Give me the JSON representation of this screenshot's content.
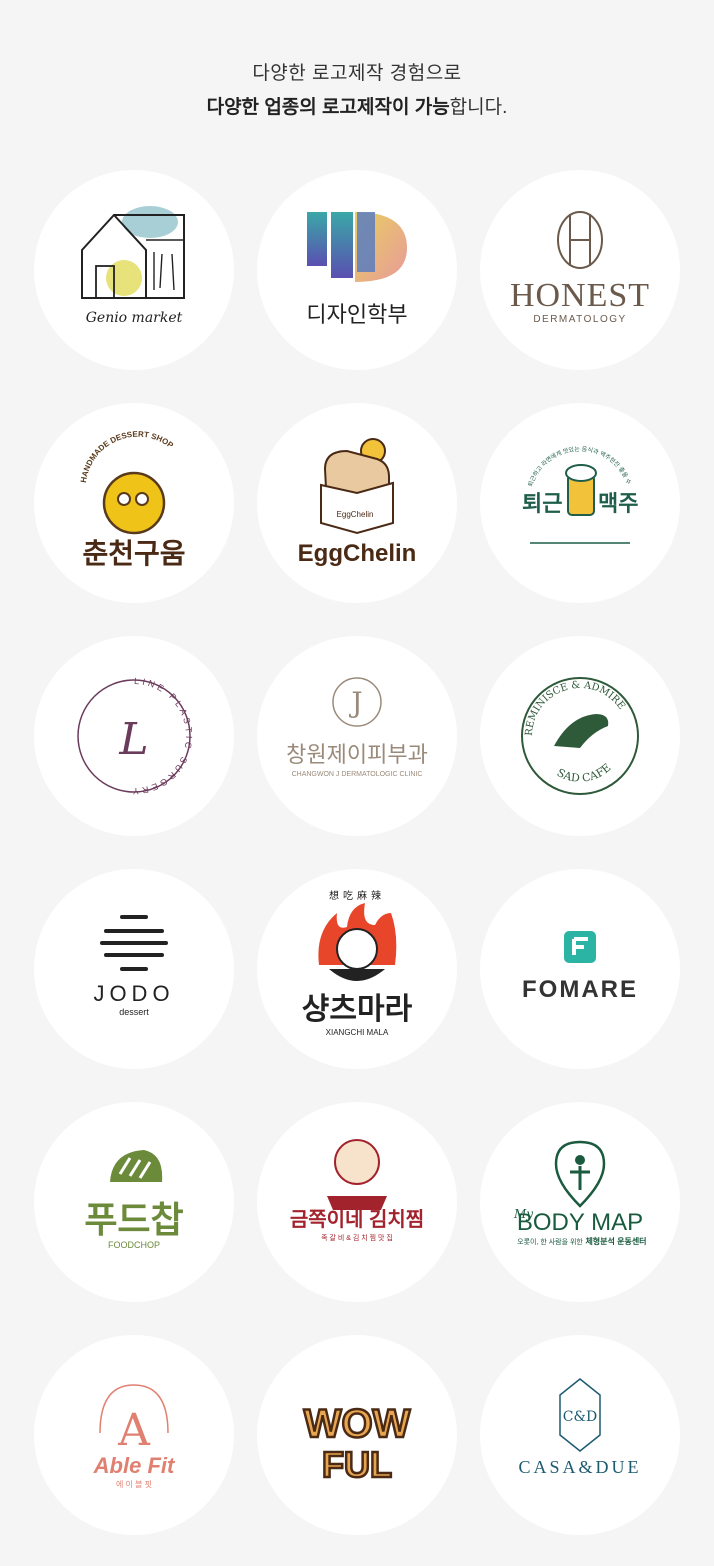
{
  "header": {
    "line1": "다양한 로고제작 경험으로",
    "line2_bold": "다양한 업종의 로고제작이 가능",
    "line2_rest": "합니다."
  },
  "logos": [
    {
      "name": "genio-market",
      "text": "Genio market"
    },
    {
      "name": "design-school",
      "text": "디자인학부"
    },
    {
      "name": "honest",
      "text": "HONEST",
      "sub": "DERMATOLOGY"
    },
    {
      "name": "chuncheon-baking",
      "text": "춘천구움",
      "sub": "HANDMADE DESSERT SHOP"
    },
    {
      "name": "eggchelin",
      "text": "EggChelin",
      "sub": "EggChelin"
    },
    {
      "name": "after-work-beer",
      "text": "퇴근",
      "text2": "맥주",
      "sub": "퇴근하고 라면에게 맛있는 음식과 맥주한잔 좋을 수 있는 곳"
    },
    {
      "name": "line-plastic",
      "text": "L",
      "sub": "LINE PLASTIC SURGERY"
    },
    {
      "name": "changwon-derma",
      "text": "창원제이피부과",
      "sub": "CHANGWON J DERMATOLOGIC CLINIC",
      "mono": "J"
    },
    {
      "name": "sad-cafe",
      "text": "REMINISCE & ADMIRE",
      "sub": "SAD CAFE"
    },
    {
      "name": "jodo",
      "text": "JODO",
      "sub": "dessert"
    },
    {
      "name": "xiangchi-mala",
      "text": "샹츠마라",
      "sub": "XIANGCHI MALA",
      "top": "想吃麻辣"
    },
    {
      "name": "fomare",
      "text": "FOMARE"
    },
    {
      "name": "foodchop",
      "text": "푸드찹",
      "sub": "FOODCHOP"
    },
    {
      "name": "kimchi-jjim",
      "text": "금쪽이네 김치찜",
      "sub": "족 갈 비 & 김 치 찜 맛 집"
    },
    {
      "name": "my-body-map",
      "text": "BODY MAP",
      "pre": "My",
      "sub": "오롯이, 한 사람을 위한",
      "sub2": "체형분석 운동센터"
    },
    {
      "name": "able-fit",
      "text": "Able Fit",
      "sub": "에 이 블 핏"
    },
    {
      "name": "wow-ful",
      "text": "WOW",
      "text2": "FUL"
    },
    {
      "name": "casa-due",
      "text": "CASA&DUE"
    }
  ],
  "colors": {
    "background": "#f5f5f5",
    "honest": "#6b5a4c",
    "beer": "#1f5e4b",
    "plastic": "#6b3b5c",
    "sad": "#2f5a3a",
    "fomare": "#2bb3a3",
    "foodchop": "#6b8a3a",
    "kimchi": "#a3232d",
    "bodymap": "#1a5a3f",
    "ablefit": "#e08070",
    "casa": "#1d5a70"
  }
}
